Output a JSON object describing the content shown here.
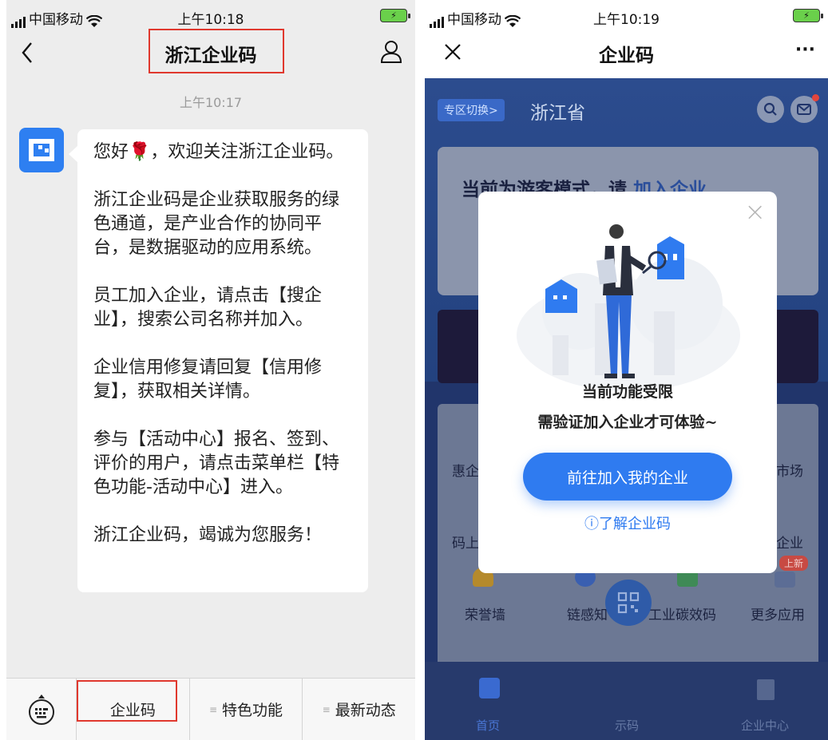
{
  "left": {
    "status": {
      "carrier": "中国移动",
      "time": "上午10:18"
    },
    "nav": {
      "title": "浙江企业码"
    },
    "chat_time": "上午10:17",
    "message": [
      "您好🌹，欢迎关注浙江企业码。",
      "浙江企业码是企业获取服务的绿色通道，是产业合作的协同平台，是数据驱动的应用系统。",
      "员工加入企业，请点击【搜企业】，搜索公司名称并加入。",
      "企业信用修复请回复【信用修复】，获取相关详情。",
      "参与【活动中心】报名、签到、评价的用户，请点击菜单栏【特色功能-活动中心】进入。",
      "浙江企业码，竭诚为您服务！"
    ],
    "menu": [
      "企业码",
      "特色功能",
      "最新动态"
    ]
  },
  "right": {
    "status": {
      "carrier": "中国移动",
      "time": "上午10:19"
    },
    "nav": {
      "title": "企业码",
      "more": "···"
    },
    "zone_button": "专区切换>",
    "province": "浙江省",
    "guest_text_a": "当前为游客模式，请",
    "guest_text_b": "加入企业",
    "grid_labels": [
      "惠企",
      "市场",
      "码上",
      "企业",
      "荣誉墙",
      "链感知",
      "工业碳效码",
      "更多应用"
    ],
    "new_badge": "上新",
    "modal": {
      "line1": "当前功能受限",
      "line2": "需验证加入企业才可体验~",
      "button": "前往加入我的企业",
      "learn": "ⓘ了解企业码"
    },
    "tabs": [
      "首页",
      "示码",
      "企业中心"
    ]
  },
  "colors": {
    "accent": "#2f7bf0",
    "highlight_box": "#e0382e",
    "app_dark": "#21356b"
  }
}
